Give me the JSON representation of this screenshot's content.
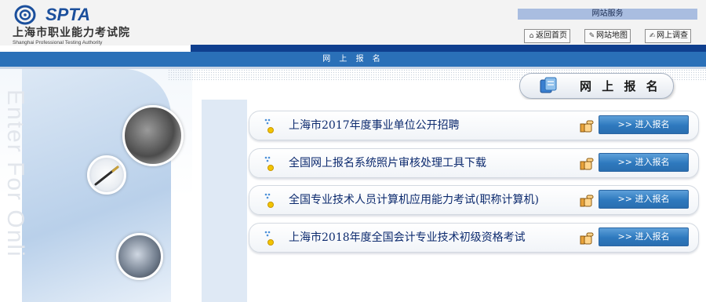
{
  "header": {
    "logo_abbr": "SPTA",
    "logo_cn": "上海市职业能力考试院",
    "logo_en": "Shanghai Professional Testing Authority",
    "services_title": "网站服务",
    "buttons": [
      {
        "label": "返回首页",
        "icon": "home-icon"
      },
      {
        "label": "网站地图",
        "icon": "sitemap-icon"
      },
      {
        "label": "网上调查",
        "icon": "survey-icon"
      }
    ]
  },
  "nav": {
    "label": "网 上 报 名"
  },
  "left_panel": {
    "vertical_text": "Enter For Onli"
  },
  "section": {
    "title": "网 上 报 名"
  },
  "rows": [
    {
      "title": "上海市2017年度事业单位公开招聘",
      "button": ">>  进入报名"
    },
    {
      "title": "全国网上报名系统照片审核处理工具下载",
      "button": ">>  进入报名"
    },
    {
      "title": "全国专业技术人员计算机应用能力考试(职称计算机)",
      "button": ">>  进入报名"
    },
    {
      "title": "上海市2018年度全国会计专业技术初级资格考试",
      "button": ">>  进入报名"
    }
  ],
  "colors": {
    "brand_blue": "#1b4f9c",
    "nav_blue": "#2a70b8",
    "strip_dark_blue": "#0f3f8e",
    "title_text": "#0c2a6e",
    "button_blue": "#2e79be"
  }
}
